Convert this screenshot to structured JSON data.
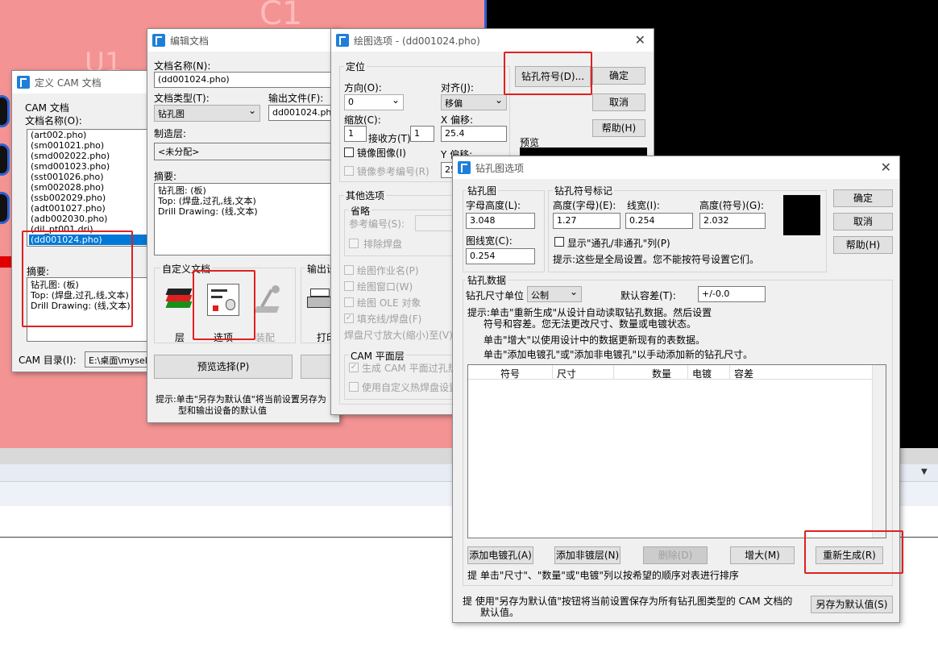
{
  "background": {
    "pcb_labels": [
      "C1",
      "U1"
    ],
    "pcb_color": "#f49393",
    "accent_red": "#e02020"
  },
  "cam_window": {
    "title": "定义 CAM 文档",
    "group_label": "CAM 文档",
    "filename_label": "文档名称(O):",
    "files": [
      "(art002.pho)",
      "(sm001021.pho)",
      "(smd002022.pho)",
      "(smd001023.pho)",
      "(sst001026.pho)",
      "(sm002028.pho)",
      "(ssb002029.pho)",
      "(adt001027.pho)",
      "(adb002030.pho)",
      "(dil_pt001.dri)",
      "(dd001024.pho)"
    ],
    "summary_label": "摘要:",
    "summary_lines": [
      "钻孔图: (板)",
      "Top: (焊盘,过孔,线,文本)",
      "Drill Drawing: (线,文本)"
    ],
    "cam_dir_label": "CAM 目录(I):",
    "cam_dir_value": "E:\\桌面\\myself"
  },
  "edit_window": {
    "title": "编辑文档",
    "doc_name_label": "文档名称(N):",
    "doc_name_value": "(dd001024.pho)",
    "doc_type_label": "文档类型(T):",
    "doc_type_value": "钻孔图",
    "output_label": "输出文件(F):",
    "output_value": "dd001024.pho",
    "layer_label": "制造层:",
    "layer_value": "<未分配>",
    "summary_label": "摘要:",
    "summary_lines": [
      "钻孔图: (板)",
      "Top: (焊盘,过孔,线,文本)",
      "Drill Drawing: (线,文本)"
    ],
    "custom_group": "自定义文档",
    "output_group": "输出设",
    "icon_layers": "层",
    "icon_options": "选项",
    "icon_assembly": "装配",
    "icon_print": "打印",
    "preview_button": "预览选择(P)",
    "hint_lines": [
      "提示:单击\"另存为默认值\"将当前设置另存为",
      "型和输出设备的默认值"
    ]
  },
  "plot_window": {
    "title": "绘图选项 - (dd001024.pho)",
    "locate_group": "定位",
    "direction_label": "方向(O):",
    "direction_value": "0",
    "align_label": "对齐(J):",
    "align_value": "移偏",
    "scale_label": "缩放(C):",
    "scale_value": "1",
    "fit_label": "接收方(T)",
    "fit_value": "1",
    "xoffset_label": "X 偏移:",
    "xoffset_value": "25.4",
    "mirror_label": "镜像图像(I)",
    "yoffset_label": "Y 偏移:",
    "yoffset_value": "25",
    "mirror_ref_label": "镜像参考编号(R)",
    "drill_symbol_button": "钻孔符号(D)...",
    "ok": "确定",
    "cancel": "取消",
    "help": "帮助(H)",
    "preview_label": "预览",
    "other_group": "其他选项",
    "omit_group": "省略",
    "ref_label": "参考编号(S):",
    "exclude_pad": "排除焊盘",
    "plot_job": "绘图作业名(P)",
    "plot_window_opt": "绘图窗口(W)",
    "plot_ole": "绘图 OLE 对象",
    "fill_pad": "填充线/焊盘(F)",
    "pad_scale": "焊盘尺寸放大(缩小)至(V):",
    "cam_plane_group": "CAM 平面层",
    "gen_cam_plane": "生成 CAM 平面过孔热",
    "use_custom_pad": "使用自定义热焊盘设置"
  },
  "drill_window": {
    "title": "钻孔图选项",
    "drill_group": "钻孔图",
    "char_height_label": "字母高度(L):",
    "char_height_value": "3.048",
    "line_width_label": "图线宽(C):",
    "line_width_value": "0.254",
    "symbol_group": "钻孔符号标记",
    "sym_char_height_label": "高度(字母)(E):",
    "sym_char_height_value": "1.27",
    "sym_line_width_label": "线宽(I):",
    "sym_line_width_value": "0.254",
    "sym_height_label": "高度(符号)(G):",
    "sym_height_value": "2.032",
    "show_plated_label": "显示\"通孔/非通孔\"列(P)",
    "global_hint": "提示:这些是全局设置。您不能按符号设置它们。",
    "ok": "确定",
    "cancel": "取消",
    "help": "帮助(H)",
    "data_group": "钻孔数据",
    "unit_label": "钻孔尺寸单位",
    "unit_value": "公制",
    "tolerance_label": "默认容差(T):",
    "tolerance_value": "+/-0.0",
    "hint_lines": [
      "提示:单击\"重新生成\"从设计自动读取钻孔数据。然后设置",
      "符号和容差。您无法更改尺寸、数量或电镀状态。",
      "单击\"增大\"以使用设计中的数据更新现有的表数据。",
      "单击\"添加电镀孔\"或\"添加非电镀孔\"以手动添加新的钻孔尺寸。"
    ],
    "columns": [
      "符号",
      "尺寸",
      "数量",
      "电镀",
      "容差"
    ],
    "add_plated": "添加电镀孔(A)",
    "add_nonplated": "添加非镀层(N)",
    "delete": "删除(D)",
    "increase": "增大(M)",
    "regenerate": "重新生成(R)",
    "sort_hint": "提  单击\"尺寸\"、\"数量\"或\"电镀\"列以按希望的顺序对表进行排序",
    "bottom_hint_lines": [
      "提  使用\"另存为默认值\"按钮将当前设置保存为所有钻孔图类型的 CAM 文档的",
      "默认值。"
    ],
    "save_default": "另存为默认值(S)"
  }
}
